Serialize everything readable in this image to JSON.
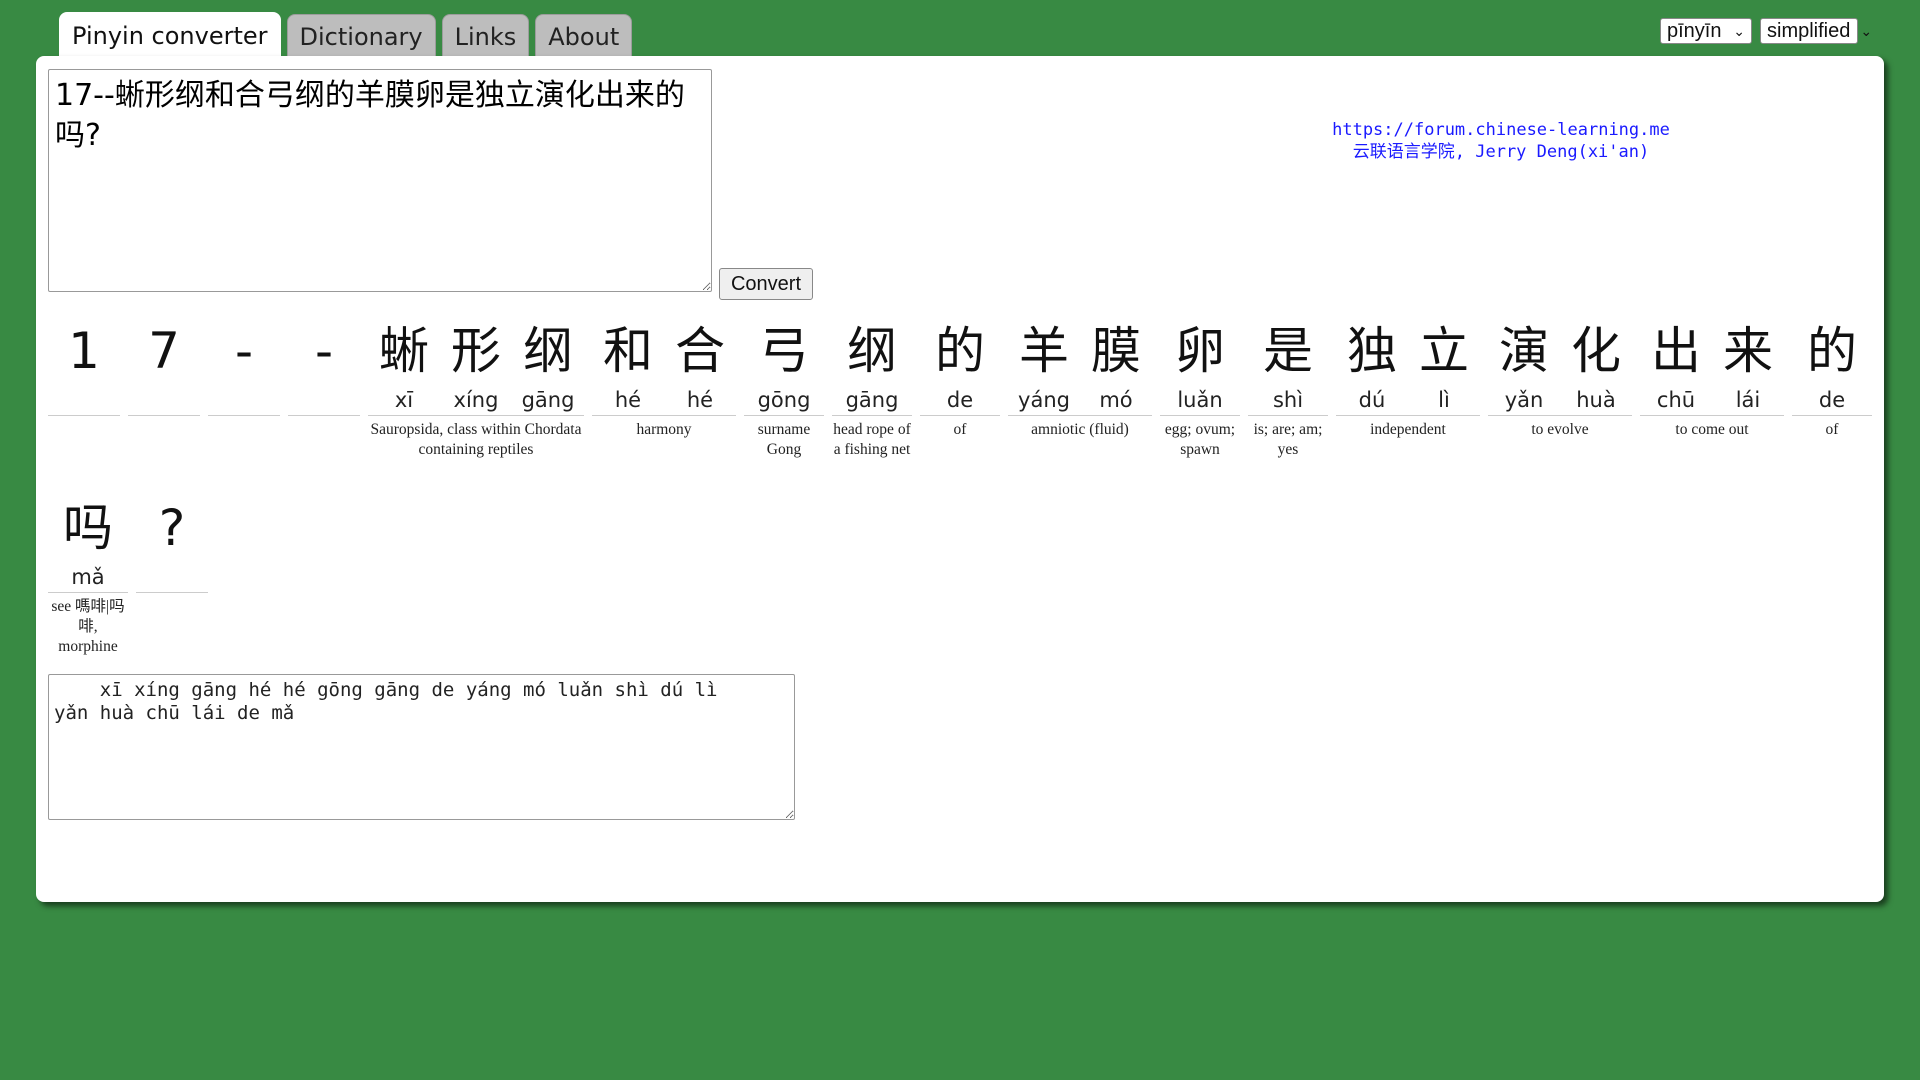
{
  "tabs": [
    "Pinyin converter",
    "Dictionary",
    "Links",
    "About"
  ],
  "active_tab": "Pinyin converter",
  "selects": {
    "mode": "pīnyīn",
    "script": "simplified"
  },
  "input_text": "17--蜥形纲和合弓纲的羊膜卵是独立演化出来的吗?",
  "convert_label": "Convert",
  "credits": {
    "url": "https://forum.chinese-learning.me",
    "line2": "云联语言学院, Jerry Deng(xi'an)"
  },
  "row1": [
    {
      "chars": [
        {
          "hz": "1",
          "py": ""
        }
      ],
      "def": ""
    },
    {
      "chars": [
        {
          "hz": "7",
          "py": ""
        }
      ],
      "def": ""
    },
    {
      "chars": [
        {
          "hz": "-",
          "py": ""
        }
      ],
      "def": ""
    },
    {
      "chars": [
        {
          "hz": "-",
          "py": ""
        }
      ],
      "def": ""
    },
    {
      "chars": [
        {
          "hz": "蜥",
          "py": "xī"
        },
        {
          "hz": "形",
          "py": "xíng"
        },
        {
          "hz": "纲",
          "py": "gāng"
        }
      ],
      "def": "Sauropsida, class within Chordata containing reptiles"
    },
    {
      "chars": [
        {
          "hz": "和",
          "py": "hé"
        },
        {
          "hz": "合",
          "py": "hé"
        }
      ],
      "def": "harmony"
    },
    {
      "chars": [
        {
          "hz": "弓",
          "py": "gōng"
        }
      ],
      "def": "surname Gong"
    },
    {
      "chars": [
        {
          "hz": "纲",
          "py": "gāng"
        }
      ],
      "def": "head rope of a fishing net"
    },
    {
      "chars": [
        {
          "hz": "的",
          "py": "de"
        }
      ],
      "def": "of"
    },
    {
      "chars": [
        {
          "hz": "羊",
          "py": "yáng"
        },
        {
          "hz": "膜",
          "py": "mó"
        }
      ],
      "def": "amniotic (fluid)"
    },
    {
      "chars": [
        {
          "hz": "卵",
          "py": "luǎn"
        }
      ],
      "def": "egg; ovum; spawn"
    },
    {
      "chars": [
        {
          "hz": "是",
          "py": "shì"
        }
      ],
      "def": "is; are; am; yes"
    },
    {
      "chars": [
        {
          "hz": "独",
          "py": "dú"
        },
        {
          "hz": "立",
          "py": "lì"
        }
      ],
      "def": "independent"
    },
    {
      "chars": [
        {
          "hz": "演",
          "py": "yǎn"
        },
        {
          "hz": "化",
          "py": "huà"
        }
      ],
      "def": "to evolve"
    },
    {
      "chars": [
        {
          "hz": "出",
          "py": "chū"
        },
        {
          "hz": "来",
          "py": "lái"
        }
      ],
      "def": "to come out"
    },
    {
      "chars": [
        {
          "hz": "的",
          "py": "de"
        }
      ],
      "def": "of"
    }
  ],
  "row2": [
    {
      "chars": [
        {
          "hz": "吗",
          "py": "mǎ"
        }
      ],
      "def": "see 嗎啡|吗啡, morphine"
    },
    {
      "chars": [
        {
          "hz": "?",
          "py": ""
        }
      ],
      "def": ""
    }
  ],
  "output_text": "    xī xíng gāng hé hé gōng gāng de yáng mó luǎn shì dú lì\nyǎn huà chū lái de mǎ"
}
